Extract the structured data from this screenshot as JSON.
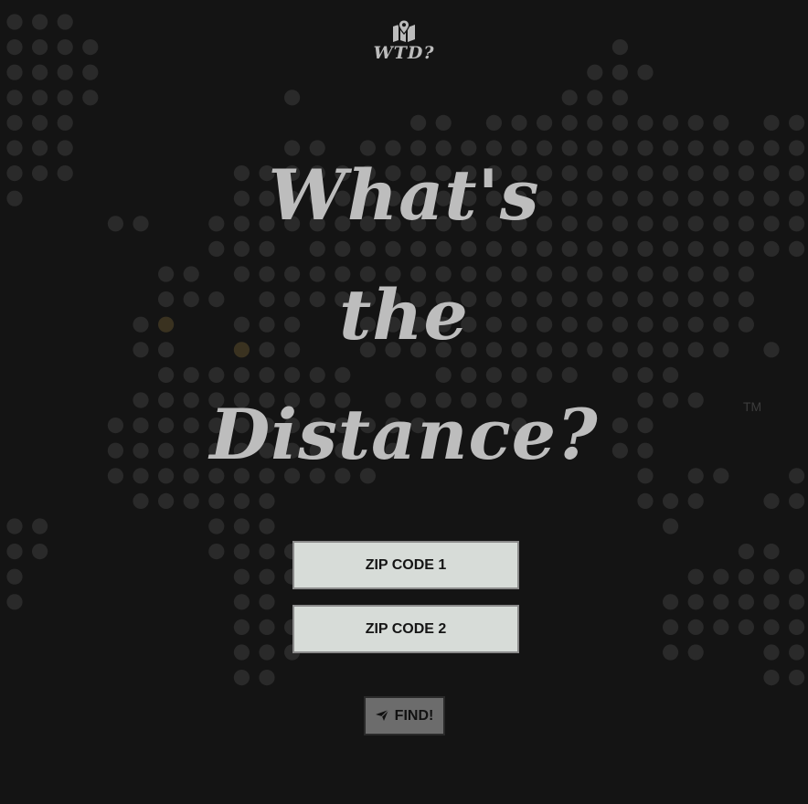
{
  "brand": {
    "logo_icon": "map-marker-icon",
    "name": "WTD?"
  },
  "headline": {
    "line1": "What's",
    "line2": "the",
    "line3": "Distance?"
  },
  "background": {
    "pattern": "dotted-world-map",
    "trademark": "TM"
  },
  "form": {
    "zip1_placeholder": "ZIP CODE 1",
    "zip1_value": "",
    "zip2_placeholder": "ZIP CODE 2",
    "zip2_value": "",
    "find_label": "FIND!",
    "find_icon": "send-icon"
  },
  "colors": {
    "background": "#141414",
    "dot": "#2a2a2a",
    "dot_highlight": "#3a3220",
    "headline": "#bdbdbd",
    "input_bg": "#d7dcd8",
    "button_bg": "#6c6c6c"
  }
}
